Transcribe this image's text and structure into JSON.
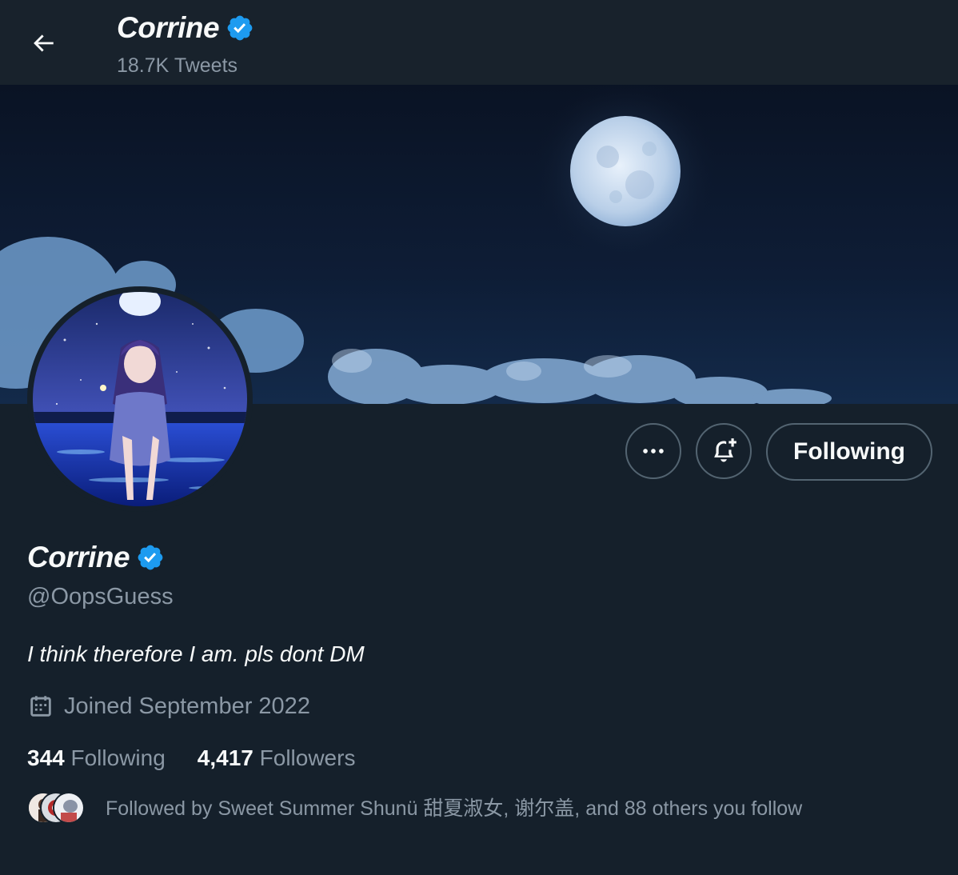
{
  "header": {
    "name": "Corrine",
    "tweet_count": "18.7K Tweets"
  },
  "profile": {
    "name": "Corrine",
    "handle": "@OopsGuess",
    "bio": "I think therefore I am. pls dont DM",
    "joined": "Joined September 2022",
    "following_count": "344",
    "following_label": "Following",
    "followers_count": "4,417",
    "followers_label": "Followers",
    "followed_by": "Followed by Sweet Summer Shunü 甜夏淑女, 谢尔盖, and 88 others you follow"
  },
  "actions": {
    "follow_state_label": "Following"
  },
  "icons": [
    "back-arrow-icon",
    "verified-badge-icon",
    "more-icon",
    "bell-plus-icon",
    "calendar-icon"
  ],
  "colors": {
    "background": "#15202b",
    "verified": "#1d9bf0",
    "muted_text": "#8b98a5"
  }
}
